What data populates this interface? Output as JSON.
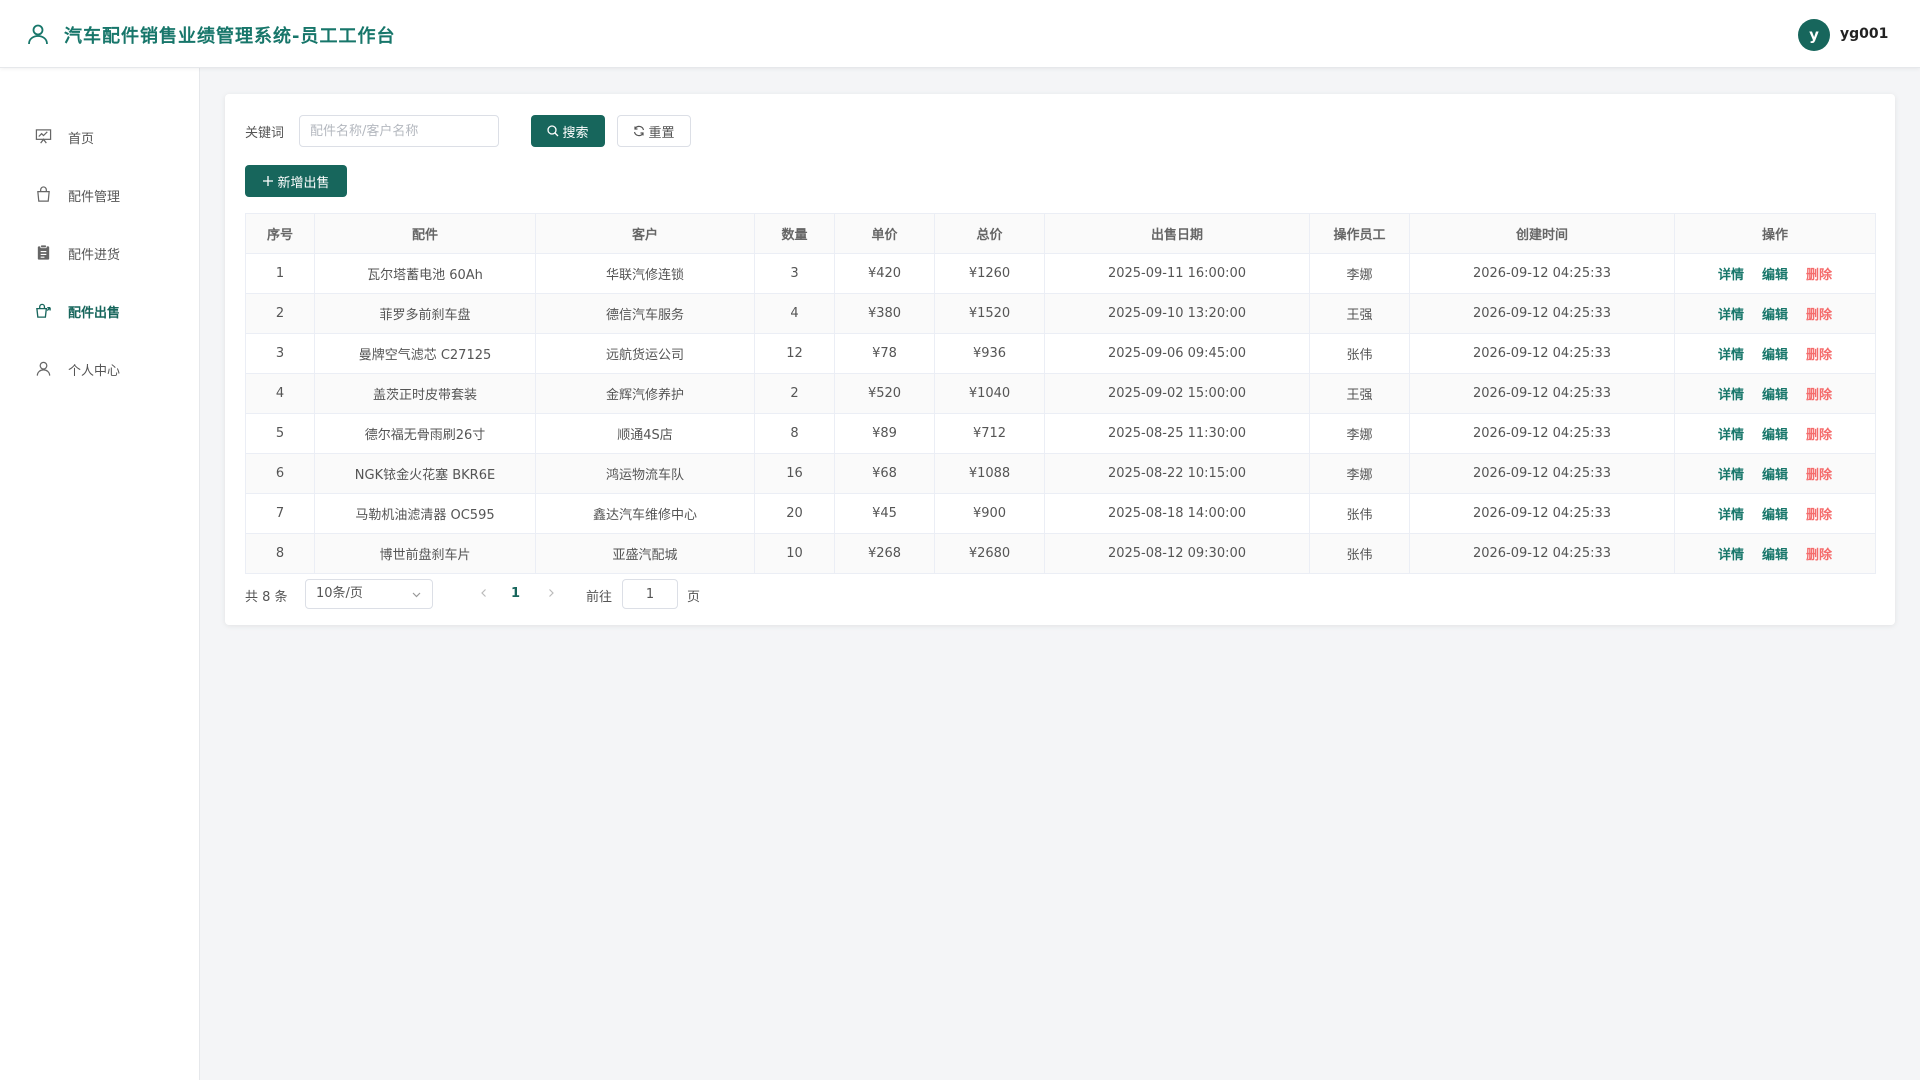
{
  "header": {
    "title": "汽车配件销售业绩管理系统-员工工作台",
    "avatar_letter": "y",
    "username": "yg001"
  },
  "sidebar": {
    "items": [
      {
        "label": "首页",
        "icon": "presentation-icon"
      },
      {
        "label": "配件管理",
        "icon": "bag-icon"
      },
      {
        "label": "配件进货",
        "icon": "clipboard-icon"
      },
      {
        "label": "配件出售",
        "icon": "sell-icon",
        "active": true
      },
      {
        "label": "个人中心",
        "icon": "user-icon"
      }
    ]
  },
  "search": {
    "label": "关键词",
    "placeholder": "配件名称/客户名称",
    "value": "",
    "search_label": "搜索",
    "reset_label": "重置",
    "add_label": "新增出售"
  },
  "table": {
    "columns": [
      "序号",
      "配件",
      "客户",
      "数量",
      "单价",
      "总价",
      "出售日期",
      "操作员工",
      "创建时间",
      "操作"
    ],
    "rows": [
      [
        "1",
        "瓦尔塔蓄电池 60Ah",
        "华联汽修连锁",
        "3",
        "¥420",
        "¥1260",
        "2025-09-11 16:00:00",
        "李娜",
        "2026-09-12 04:25:33"
      ],
      [
        "2",
        "菲罗多前刹车盘",
        "德信汽车服务",
        "4",
        "¥380",
        "¥1520",
        "2025-09-10 13:20:00",
        "王强",
        "2026-09-12 04:25:33"
      ],
      [
        "3",
        "曼牌空气滤芯 C27125",
        "远航货运公司",
        "12",
        "¥78",
        "¥936",
        "2025-09-06 09:45:00",
        "张伟",
        "2026-09-12 04:25:33"
      ],
      [
        "4",
        "盖茨正时皮带套装",
        "金辉汽修养护",
        "2",
        "¥520",
        "¥1040",
        "2025-09-02 15:00:00",
        "王强",
        "2026-09-12 04:25:33"
      ],
      [
        "5",
        "德尔福无骨雨刷26寸",
        "顺通4S店",
        "8",
        "¥89",
        "¥712",
        "2025-08-25 11:30:00",
        "李娜",
        "2026-09-12 04:25:33"
      ],
      [
        "6",
        "NGK铱金火花塞 BKR6E",
        "鸿运物流车队",
        "16",
        "¥68",
        "¥1088",
        "2025-08-22 10:15:00",
        "李娜",
        "2026-09-12 04:25:33"
      ],
      [
        "7",
        "马勒机油滤清器 OC595",
        "鑫达汽车维修中心",
        "20",
        "¥45",
        "¥900",
        "2025-08-18 14:00:00",
        "张伟",
        "2026-09-12 04:25:33"
      ],
      [
        "8",
        "博世前盘刹车片",
        "亚盛汽配城",
        "10",
        "¥268",
        "¥2680",
        "2025-08-12 09:30:00",
        "张伟",
        "2026-09-12 04:25:33"
      ]
    ],
    "actions": {
      "detail": "详情",
      "edit": "编辑",
      "delete": "删除"
    }
  },
  "pagination": {
    "total_text": "共 8 条",
    "page_size": "10条/页",
    "current_page": "1",
    "goto_label": "前往",
    "goto_value": "1",
    "page_suffix": "页"
  },
  "colors": {
    "primary": "#17665c",
    "title": "#17766a",
    "danger": "#f56c6c"
  }
}
